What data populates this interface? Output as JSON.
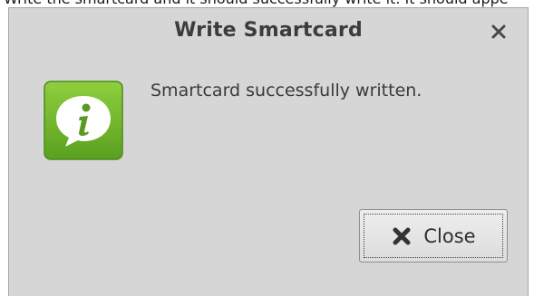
{
  "background_window": {
    "partial_text": "Write the smartcard and it should successfully write it. It should appe"
  },
  "dialog": {
    "title": "Write Smartcard",
    "close_icon": "close-x-icon",
    "info_icon": "info-speech-bubble-icon",
    "message": "Smartcard successfully written.",
    "close_button": {
      "label": "Close",
      "icon": "close-x-icon"
    }
  },
  "colors": {
    "dialog_bg": "#d6d6d6",
    "title_text": "#3c3c3c",
    "info_icon_green": "#6bb52d",
    "button_bg": "#e6e6e6"
  }
}
